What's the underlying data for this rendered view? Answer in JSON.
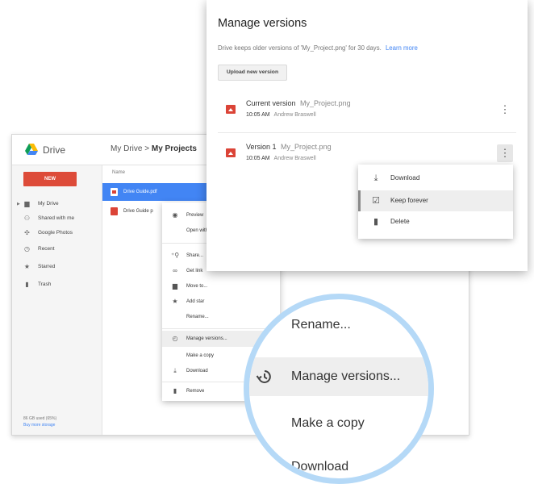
{
  "drive": {
    "app_title": "Drive",
    "breadcrumb": {
      "root": "My Drive",
      "separator": ">",
      "current": "My Projects"
    },
    "new_button": "NEW",
    "sidebar": [
      {
        "label": "My Drive",
        "icon": "folder-icon"
      },
      {
        "label": "Shared with me",
        "icon": "people-icon"
      },
      {
        "label": "Google Photos",
        "icon": "pinwheel-icon"
      },
      {
        "label": "Recent",
        "icon": "clock-icon"
      },
      {
        "label": "Starred",
        "icon": "star-icon"
      },
      {
        "label": "Trash",
        "icon": "trash-icon"
      }
    ],
    "storage": {
      "used": "86 GB used (65%)",
      "buy": "Buy more storage"
    },
    "column_name": "Name",
    "files": [
      {
        "name": "Drive Guide.pdf",
        "selected": true
      },
      {
        "name": "Drive Guide p",
        "selected": false
      }
    ],
    "context_menu": [
      {
        "label": "Preview",
        "icon": "eye-icon"
      },
      {
        "label": "Open with",
        "icon": ""
      },
      {
        "label": "Share...",
        "icon": "person-add-icon"
      },
      {
        "label": "Get link",
        "icon": "link-icon"
      },
      {
        "label": "Move to...",
        "icon": "folder-icon"
      },
      {
        "label": "Add star",
        "icon": "star-icon"
      },
      {
        "label": "Rename...",
        "icon": ""
      },
      {
        "label": "Manage versions...",
        "icon": "history-icon"
      },
      {
        "label": "Make a copy",
        "icon": ""
      },
      {
        "label": "Download",
        "icon": "download-icon"
      },
      {
        "label": "Remove",
        "icon": "trash-icon"
      }
    ]
  },
  "dialog": {
    "title": "Manage versions",
    "description": "Drive keeps older versions of 'My_Project.png' for 30 days.",
    "learn_more": "Learn more",
    "upload_button": "Upload new version",
    "versions": [
      {
        "label": "Current version",
        "file": "My_Project.png",
        "time": "10:05 AM",
        "author": "Andrew Braswell"
      },
      {
        "label": "Version 1",
        "file": "My_Project.png",
        "time": "10:05 AM",
        "author": "Andrew Braswell"
      }
    ],
    "version_menu": [
      {
        "label": "Download",
        "icon": "download-icon"
      },
      {
        "label": "Keep forever",
        "icon": "checkbox-icon"
      },
      {
        "label": "Delete",
        "icon": "trash-icon"
      }
    ]
  },
  "magnifier": {
    "items": [
      "Rename...",
      "Manage versions...",
      "Make a copy",
      "Download"
    ]
  },
  "colors": {
    "accent": "#4285f4",
    "new_button": "#dd4b39",
    "file_icon": "#db4437",
    "magnifier_ring": "#b5d9f7"
  }
}
